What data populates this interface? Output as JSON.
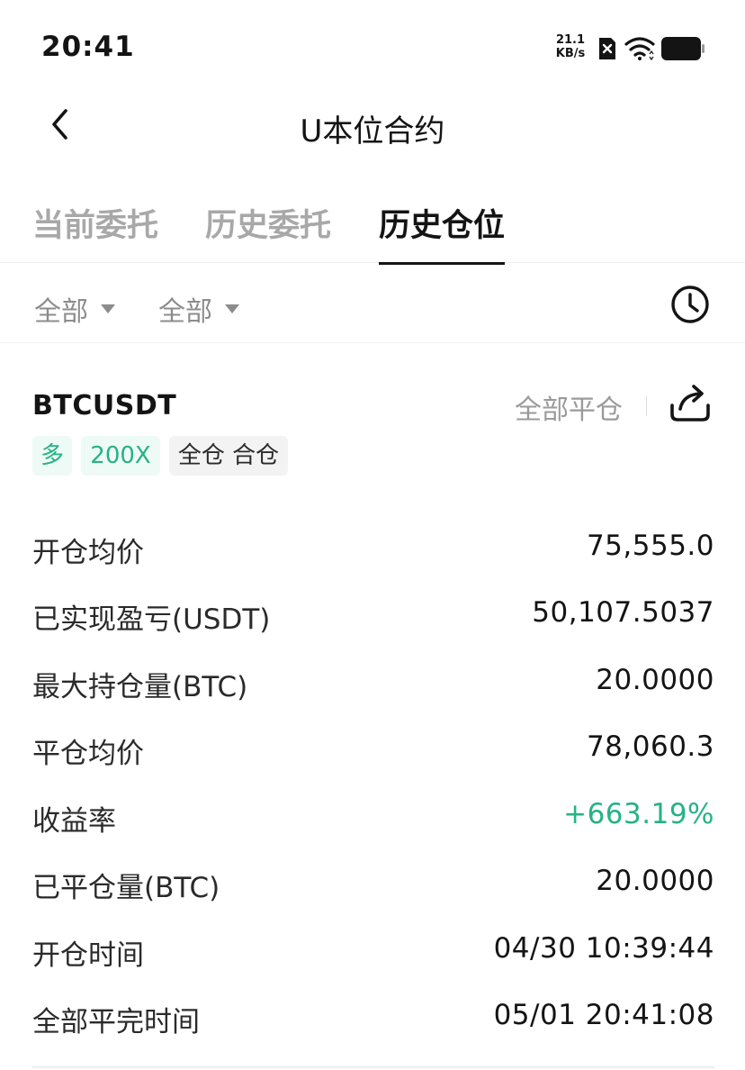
{
  "status_bar": {
    "time": "20:41",
    "net_speed_value": "21.1",
    "net_speed_unit": "KB/s",
    "icons": [
      "no-sim-icon",
      "wifi-icon",
      "battery-icon"
    ]
  },
  "header": {
    "title": "U本位合约",
    "back_icon": "chevron-left-icon"
  },
  "tabs": [
    {
      "label": "当前委托",
      "active": false
    },
    {
      "label": "历史委托",
      "active": false
    },
    {
      "label": "历史仓位",
      "active": true
    }
  ],
  "filters": [
    {
      "label": "全部"
    },
    {
      "label": "全部"
    }
  ],
  "position": {
    "symbol": "BTCUSDT",
    "close_all_label": "全部平仓",
    "tags": [
      "多",
      "200X",
      "全仓 合仓"
    ],
    "rows": [
      {
        "label": "开仓均价",
        "value": "75,555.0"
      },
      {
        "label": "已实现盈亏(USDT)",
        "value": "50,107.5037"
      },
      {
        "label": "最大持仓量(BTC)",
        "value": "20.0000"
      },
      {
        "label": "平仓均价",
        "value": "78,060.3"
      },
      {
        "label": "收益率",
        "value": "+663.19%"
      },
      {
        "label": "已平仓量(BTC)",
        "value": "20.0000"
      },
      {
        "label": "开仓时间",
        "value": "04/30 10:39:44"
      },
      {
        "label": "全部平完时间",
        "value": "05/01 20:41:08"
      }
    ]
  },
  "colors": {
    "accent_green": "#27b286",
    "text_primary": "#141414",
    "text_muted": "#a8a8a8"
  }
}
